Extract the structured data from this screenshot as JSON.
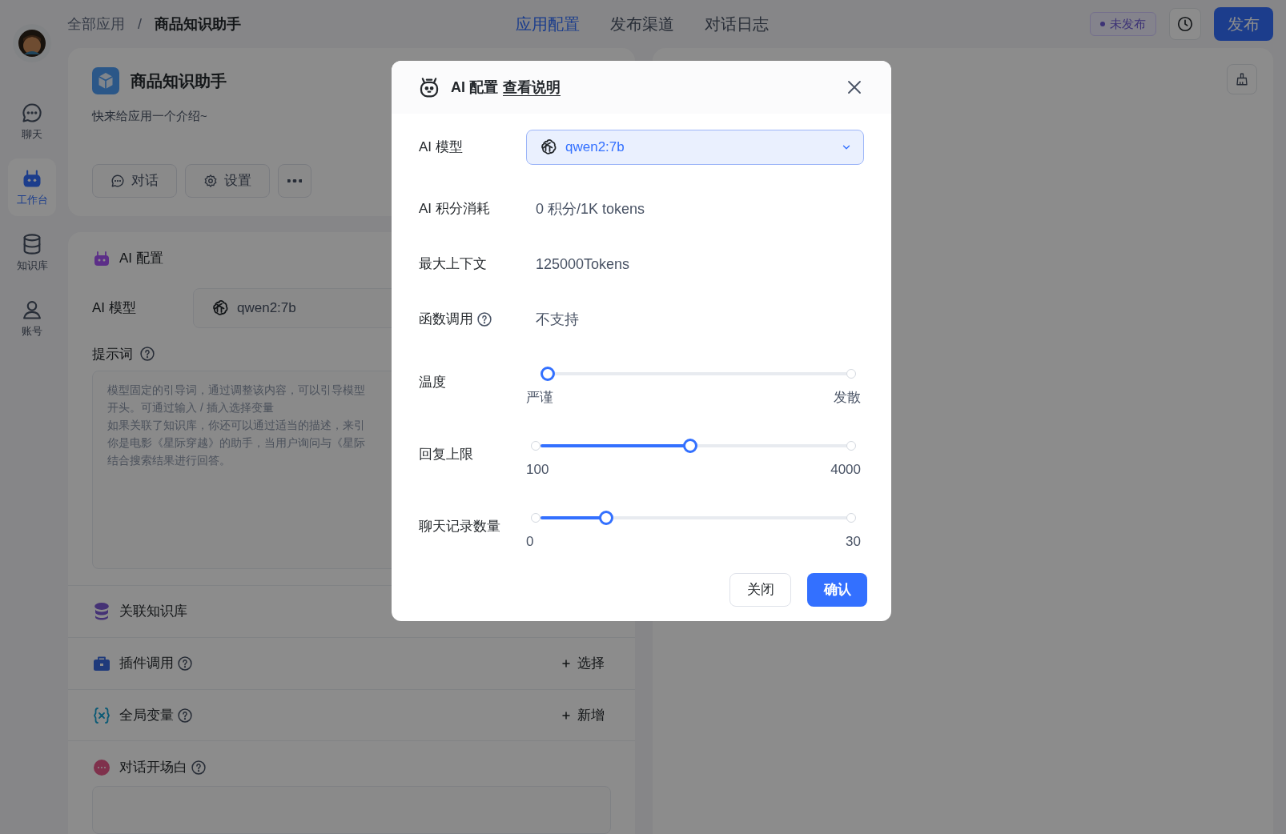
{
  "sidebar": {
    "items": [
      {
        "label": "聊天",
        "kind": "chat",
        "selected": false
      },
      {
        "label": "工作台",
        "kind": "robot",
        "selected": true
      },
      {
        "label": "知识库",
        "kind": "database",
        "selected": false
      },
      {
        "label": "账号",
        "kind": "user",
        "selected": false
      }
    ]
  },
  "header": {
    "breadcrumb": [
      "全部应用",
      "商品知识助手"
    ],
    "separator": "/",
    "tabs": [
      {
        "label": "应用配置",
        "selected": true
      },
      {
        "label": "发布渠道",
        "selected": false
      },
      {
        "label": "对话日志",
        "selected": false
      }
    ],
    "status": "未发布",
    "publish": "发布"
  },
  "app_card": {
    "title": "商品知识助手",
    "intro": "快来给应用一个介绍~",
    "actions": [
      {
        "label": "对话",
        "kind": "chat"
      },
      {
        "label": "设置",
        "kind": "gear"
      },
      {
        "kind": "more"
      }
    ]
  },
  "ai_config": {
    "title": "AI 配置",
    "model_label": "AI 模型",
    "model": "qwen2:7b",
    "prompt_label": "提示词",
    "prompt_placeholder": [
      "模型固定的引导词，通过调整该内容，可以引导模型",
      "开头。可通过输入 / 插入选择变量",
      "如果关联了知识库，你还可以通过适当的描述，来引",
      "你是电影《星际穿越》的助手，当用户询问与《星际",
      "结合搜索结果进行回答。"
    ]
  },
  "sections": [
    {
      "title": "关联知识库",
      "kind": "database",
      "help": false
    },
    {
      "title": "插件调用",
      "kind": "toolbox",
      "help": true,
      "action": "选择"
    },
    {
      "title": "全局变量",
      "kind": "variable",
      "help": true,
      "action": "新增"
    },
    {
      "title": "对话开场白",
      "kind": "bubble",
      "help": true
    }
  ],
  "modal": {
    "title": "AI 配置",
    "link": "查看说明",
    "rows": [
      {
        "kind": "select",
        "label": "AI 模型",
        "value": "qwen2:7b"
      },
      {
        "kind": "text",
        "label": "AI 积分消耗",
        "value": "0 积分/1K tokens",
        "help": false
      },
      {
        "kind": "text",
        "label": "最大上下文",
        "value": "125000Tokens",
        "help": false
      },
      {
        "kind": "text",
        "label": "函数调用",
        "value": "不支持",
        "help": true
      },
      {
        "kind": "slider",
        "label": "温度",
        "level": 0,
        "min_label": "严谨",
        "max_label": "发散"
      },
      {
        "kind": "slider",
        "label": "回复上限",
        "level": 0.49,
        "min_label": "100",
        "max_label": "4000"
      },
      {
        "kind": "slider",
        "label": "聊天记录数量",
        "level": 0.2,
        "min_label": "0",
        "max_label": "30"
      }
    ],
    "cancel": "关闭",
    "confirm": "确认"
  }
}
